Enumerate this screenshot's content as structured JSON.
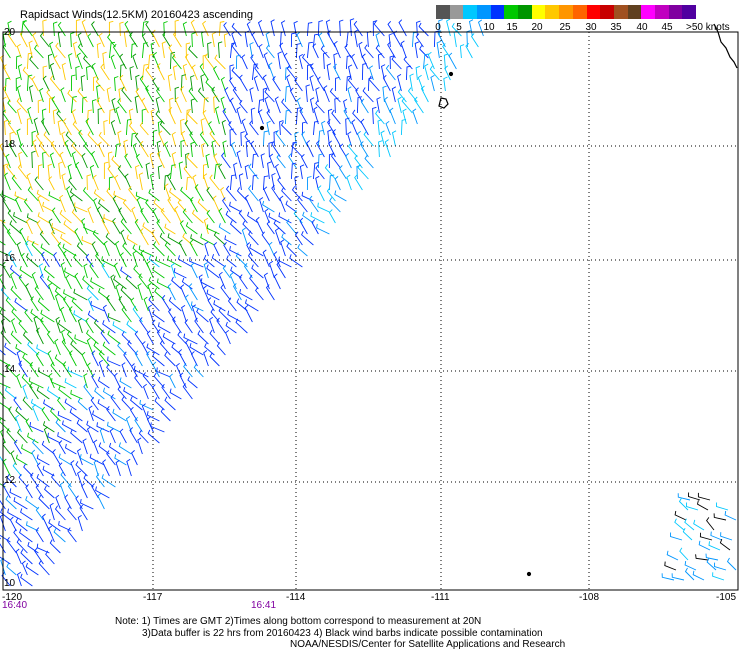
{
  "title": "Rapidsact Winds(12.5KM) 20160423 ascending",
  "legend": {
    "colors": [
      "#555555",
      "#999999",
      "#00c8ff",
      "#0096ff",
      "#0032ff",
      "#00c800",
      "#009600",
      "#ffff00",
      "#ffc800",
      "#ff9600",
      "#ff6400",
      "#ff0000",
      "#c80000",
      "#a05020",
      "#604020",
      "#ff00ff",
      "#c000c0",
      "#8000a0",
      "#5000a0"
    ],
    "labels": [
      "0",
      "5",
      "10",
      "15",
      "20",
      "25",
      "30",
      "35",
      "40",
      "45",
      ">50 knots"
    ]
  },
  "axes": {
    "lon_labels": [
      "-120",
      "-117",
      "-114",
      "-111",
      "-108",
      "-105"
    ],
    "lat_labels": [
      "20",
      "18",
      "16",
      "14",
      "12",
      "10"
    ]
  },
  "times": {
    "t1": "16:40",
    "t2": "16:41"
  },
  "notes": {
    "line1": "Note: 1) Times are GMT 2)Times along bottom correspond to measurement at 20N",
    "line2": "3)Data buffer is 22 hrs from 20160423 4) Black wind barbs indicate possible contamination",
    "line3": "NOAA/NESDIS/Center for Satellite Applications and Research"
  }
}
